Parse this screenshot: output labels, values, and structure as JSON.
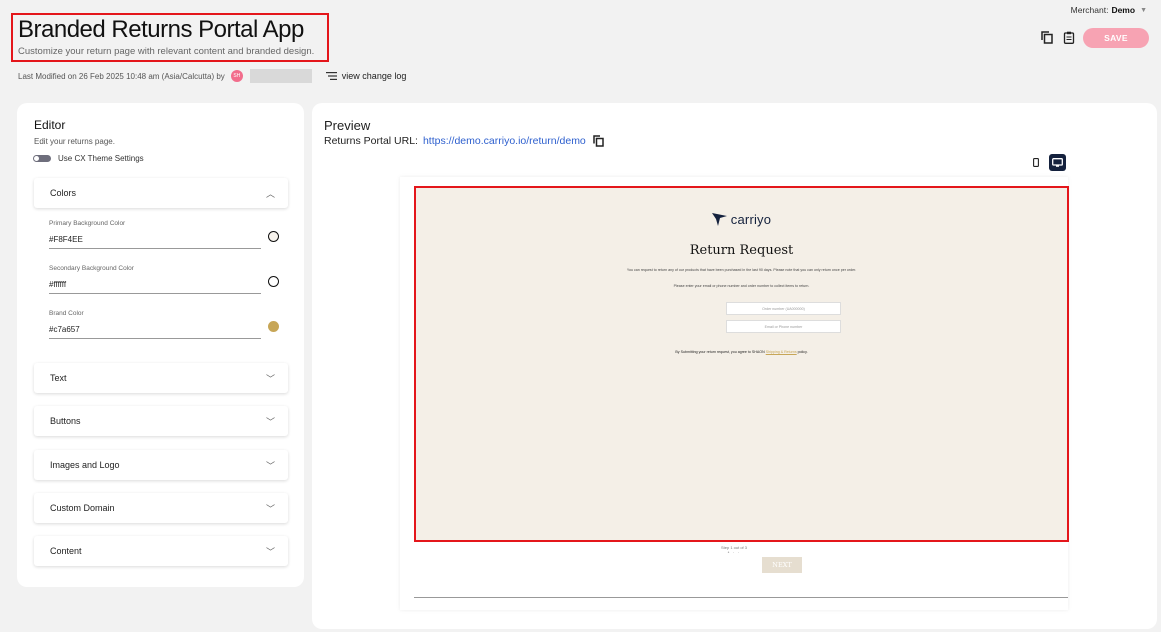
{
  "header": {
    "title": "Branded Returns Portal App",
    "subtitle": "Customize your return page with relevant content and branded design.",
    "last_modified": "Last Modified on 26 Feb 2025 10:48 am (Asia/Calcutta) by",
    "avatar_initials": "SH",
    "change_log_label": "view change log",
    "merchant_label": "Merchant:",
    "merchant_value": "Demo",
    "save_label": "SAVE"
  },
  "editor": {
    "title": "Editor",
    "subtitle": "Edit your returns page.",
    "theme_toggle_label": "Use CX Theme Settings",
    "sections": {
      "colors": "Colors",
      "text": "Text",
      "buttons": "Buttons",
      "images_logo": "Images and Logo",
      "custom_domain": "Custom Domain",
      "content": "Content"
    },
    "colors": {
      "primary_label": "Primary Background Color",
      "primary_value": "#F8F4EE",
      "secondary_label": "Secondary Background Color",
      "secondary_value": "#ffffff",
      "brand_label": "Brand Color",
      "brand_value": "#c7a657"
    }
  },
  "preview": {
    "title": "Preview",
    "url_label": "Returns Portal URL:",
    "url": "https://demo.carriyo.io/return/demo",
    "portal": {
      "logo_text": "carriyo",
      "heading": "Return Request",
      "intro": "You can request to return any of our products that have been purchased in the last 90 days. Please note that you can only return once per order.",
      "instruction": "Please enter your email or phone number and order number to collect items to return.",
      "order_placeholder": "Order number (UA000000)",
      "email_placeholder": "Email or Phone number",
      "policy_prefix": "By Submitting your return request, you agree to SHAON",
      "policy_link": "Shipping & Returns",
      "policy_suffix": "policy.",
      "step_text": "Step 1 out of 3",
      "next_label": "NEXT"
    }
  },
  "colors": {
    "accent_pink": "#f7a3b3",
    "highlight_red": "#e4161b",
    "link_blue": "#2d5fce",
    "portal_bg": "#F8F4EE",
    "brand": "#c7a657"
  }
}
